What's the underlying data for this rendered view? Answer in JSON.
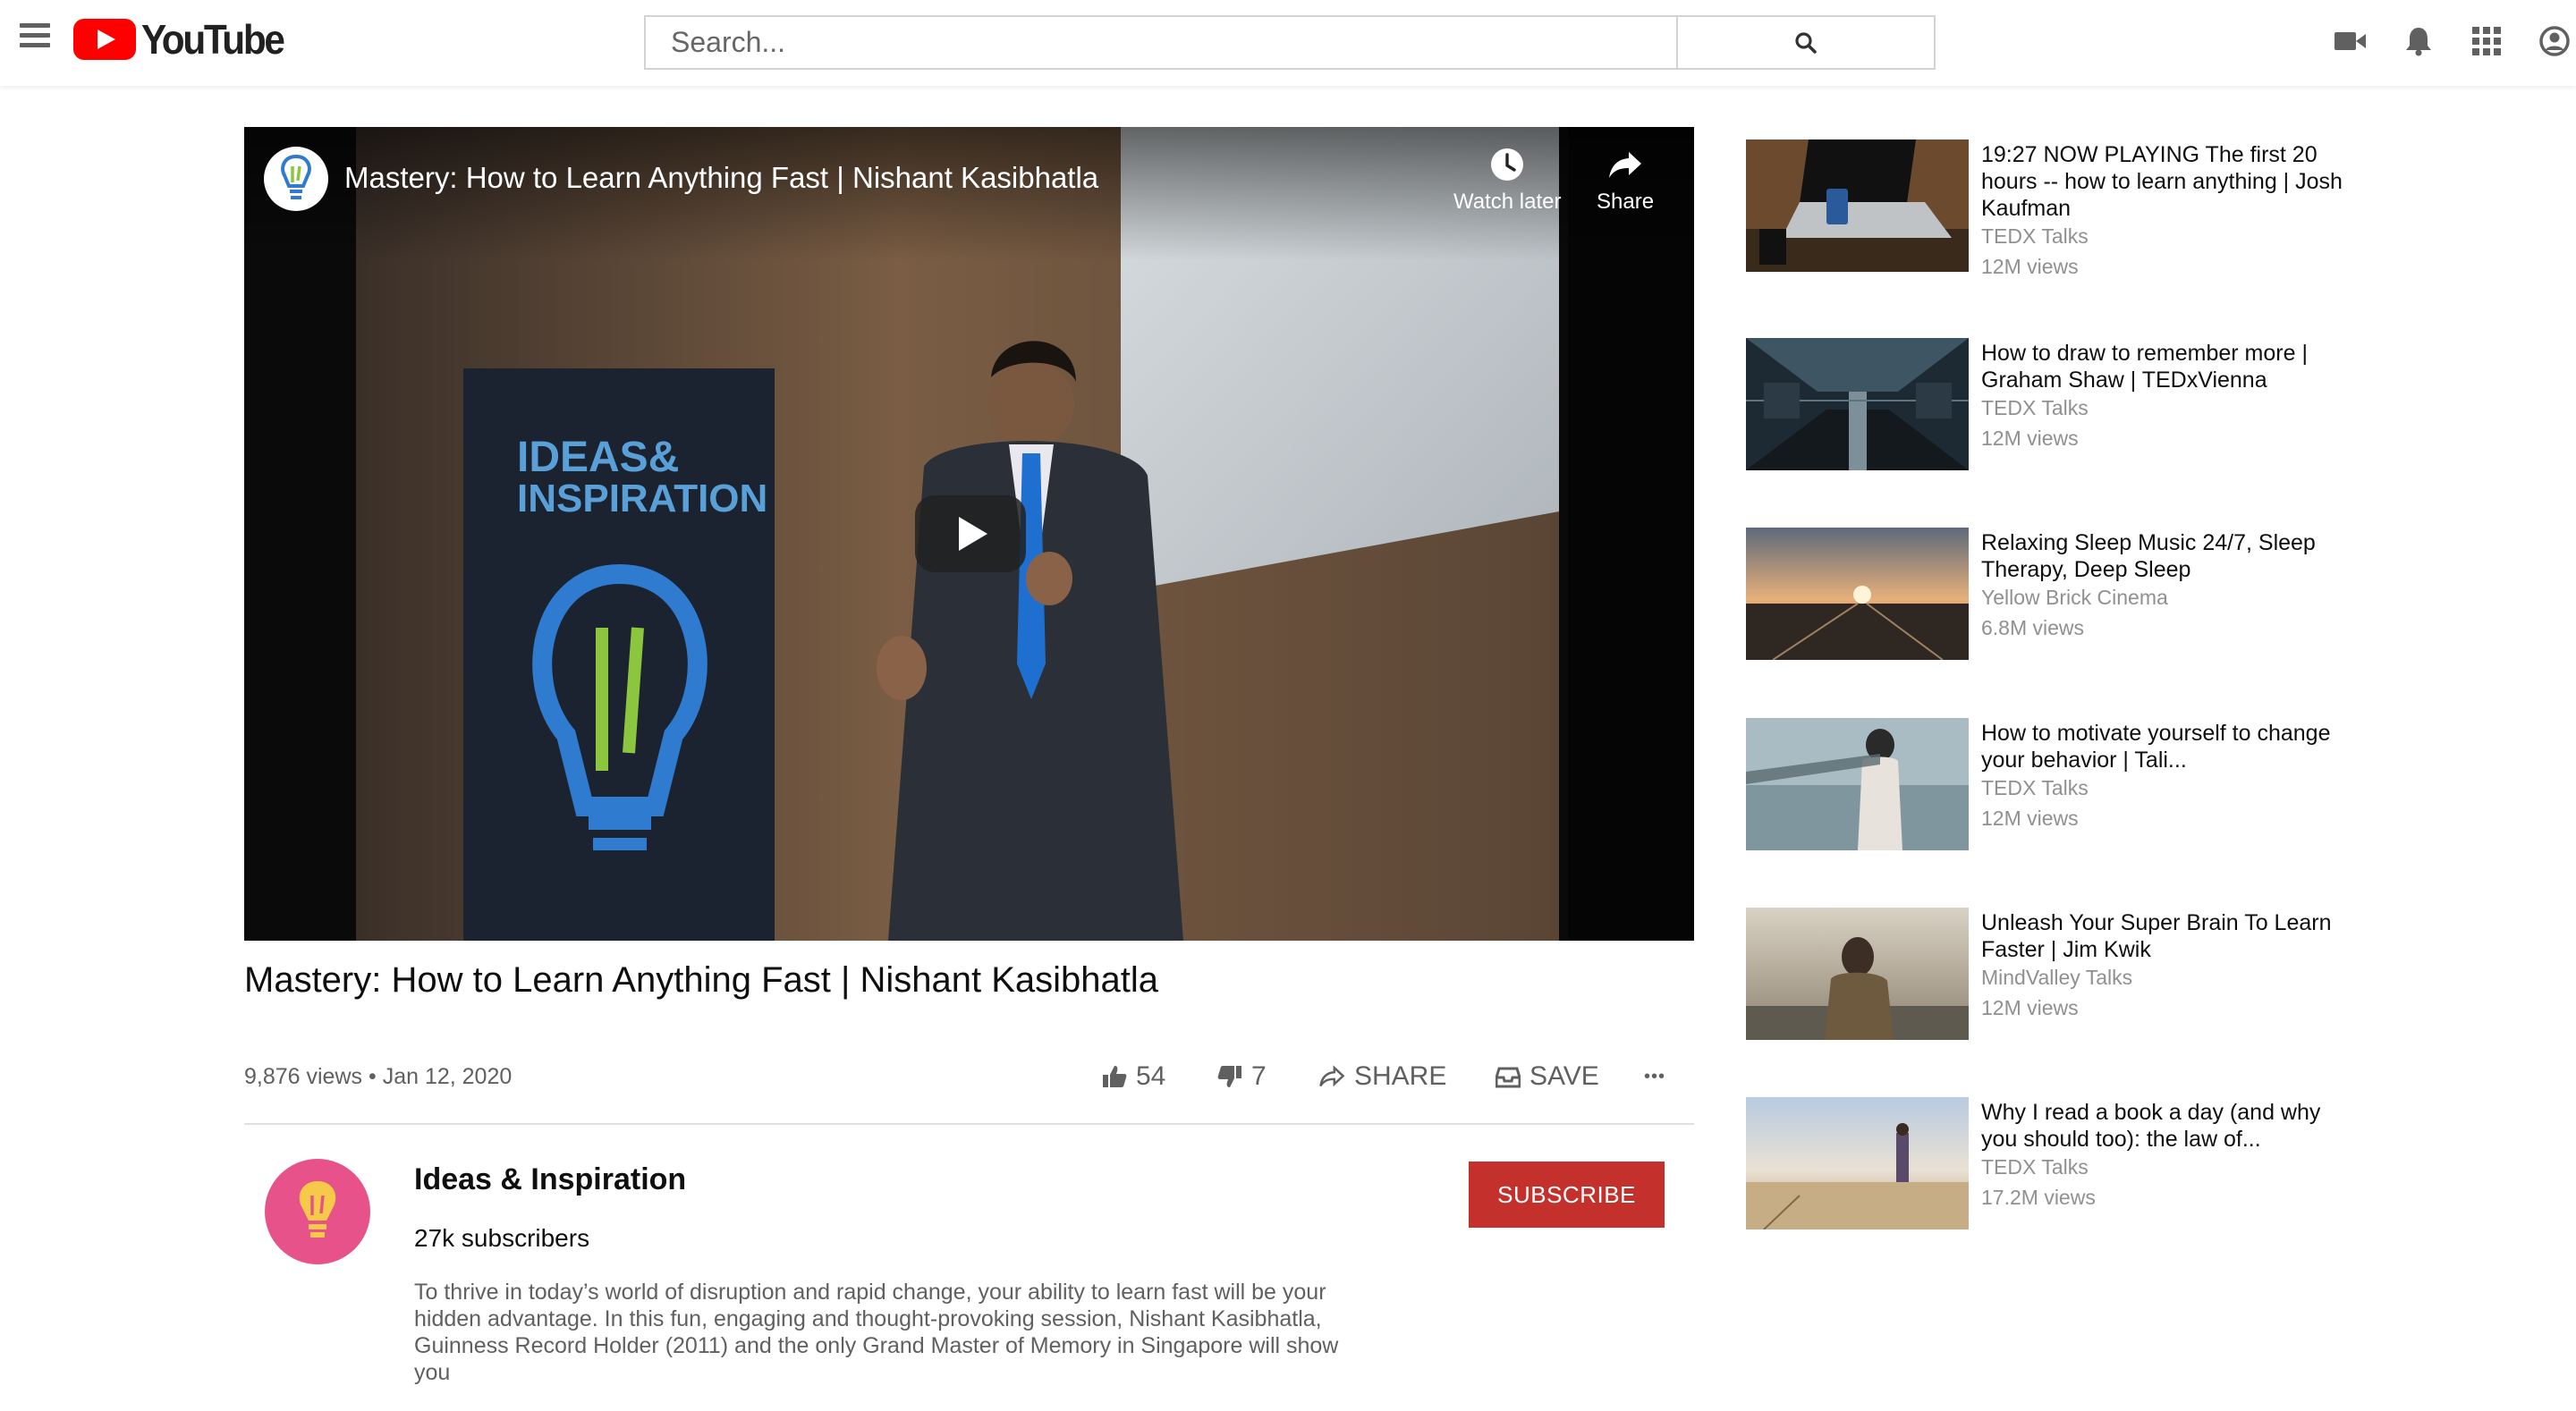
{
  "header": {
    "logo_text": "YouTube",
    "search_placeholder": "Search...",
    "icons": [
      "menu-icon",
      "video-camera-icon",
      "bell-icon",
      "apps-grid-icon",
      "account-icon"
    ]
  },
  "player": {
    "overlay_title": "Mastery: How to Learn Anything Fast | Nishant Kasibhatla",
    "watch_later_label": "Watch later",
    "share_label": "Share"
  },
  "video": {
    "title": "Mastery: How to Learn Anything Fast | Nishant Kasibhatla",
    "views": "9,876 views",
    "separator": "•",
    "date": "Jan 12, 2020",
    "likes": "54",
    "dislikes": "7",
    "share_label": "SHARE",
    "save_label": "SAVE",
    "more_label": "•••"
  },
  "owner": {
    "name": "Ideas & Inspiration",
    "subscribers": "27k subscribers",
    "subscribe_label": "SUBSCRIBE",
    "description": "To thrive in today’s world of disruption and rapid change, your ability to learn fast will be your hidden advantage. In this fun, engaging and thought-provoking session, Nishant Kasibhatla, Guinness Record Holder (2011) and the only Grand Master of Memory in Singapore will show you"
  },
  "recommendations": [
    {
      "title": "19:27 NOW PLAYING The first 20 hours -- how to learn anything | Josh Kaufman",
      "channel": "TEDX Talks",
      "views": "12M views"
    },
    {
      "title": "How to draw to remember more | Graham Shaw | TEDxVienna",
      "channel": "TEDX Talks",
      "views": "12M views"
    },
    {
      "title": "Relaxing Sleep Music 24/7, Sleep Therapy, Deep Sleep",
      "channel": "Yellow Brick Cinema",
      "views": "6.8M views"
    },
    {
      "title": "How to motivate yourself to change your behavior | Tali...",
      "channel": "TEDX Talks",
      "views": "12M views"
    },
    {
      "title": "Unleash Your Super Brain To Learn Faster | Jim Kwik",
      "channel": "MindValley Talks",
      "views": "12M views"
    },
    {
      "title": "Why I read a book a day (and why you should too): the law of...",
      "channel": "TEDX Talks",
      "views": "17.2M views"
    }
  ],
  "colors": {
    "brand_red": "#ff0000",
    "subscribe_red": "#c4302b",
    "secondary_text": "#606060",
    "sidebar_meta_text": "#909090"
  }
}
